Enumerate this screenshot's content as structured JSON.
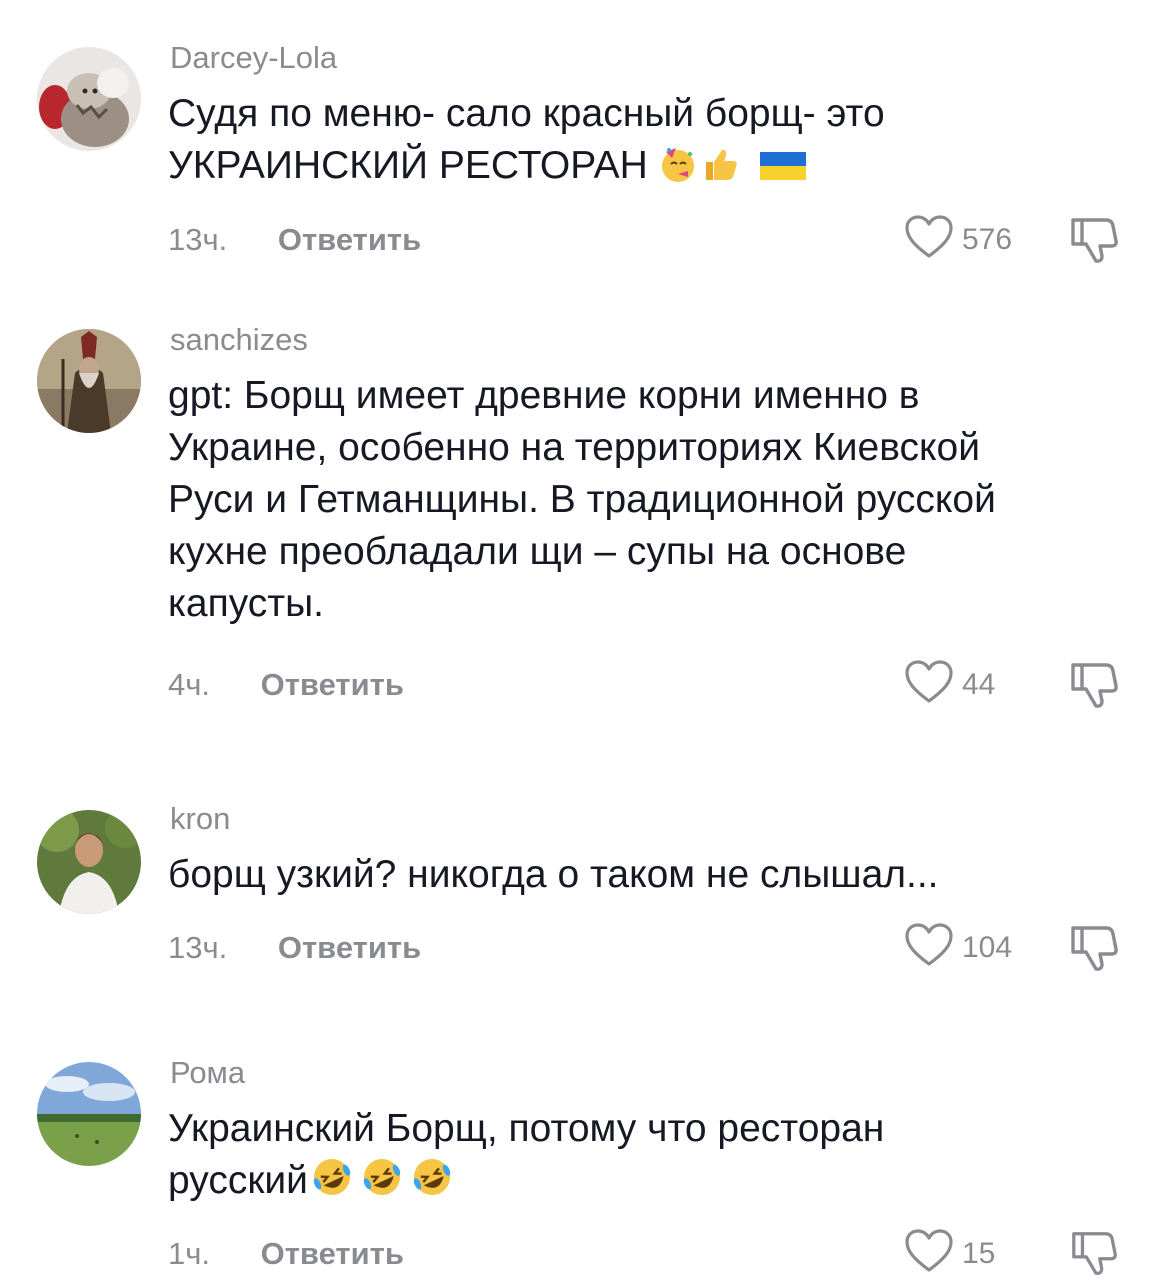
{
  "reply_label": "Ответить",
  "comments": [
    {
      "username": "Darcey-Lola",
      "text": "Судя по меню- сало красный борщ- это\nУКРАИНСКИЙ РЕСТОРАН",
      "time": "13ч.",
      "likes": "576"
    },
    {
      "username": "sanchizes",
      "text": "gpt: Борщ имеет древние корни именно в\nУкраине, особенно на территориях Киевской\nРуси и Гетманщины. В традиционной русской\nкухне преобладали щи – супы на основе\nкапусты.",
      "time": "4ч.",
      "likes": "44"
    },
    {
      "username": "kron",
      "text": "борщ узкий? никогда о таком не слышал...",
      "time": "13ч.",
      "likes": "104"
    },
    {
      "username": "Рома",
      "text": "Украинский Борщ, потому что ресторан\nрусский",
      "time": "1ч.",
      "likes": "15"
    }
  ],
  "colors": {
    "text": "#161823",
    "muted": "#8a8b91"
  },
  "icons": [
    "heart-outline-icon",
    "dislike-icon",
    "partying-face-emoji",
    "thumbs-up-emoji",
    "ukraine-flag-emoji",
    "rofl-emoji"
  ]
}
